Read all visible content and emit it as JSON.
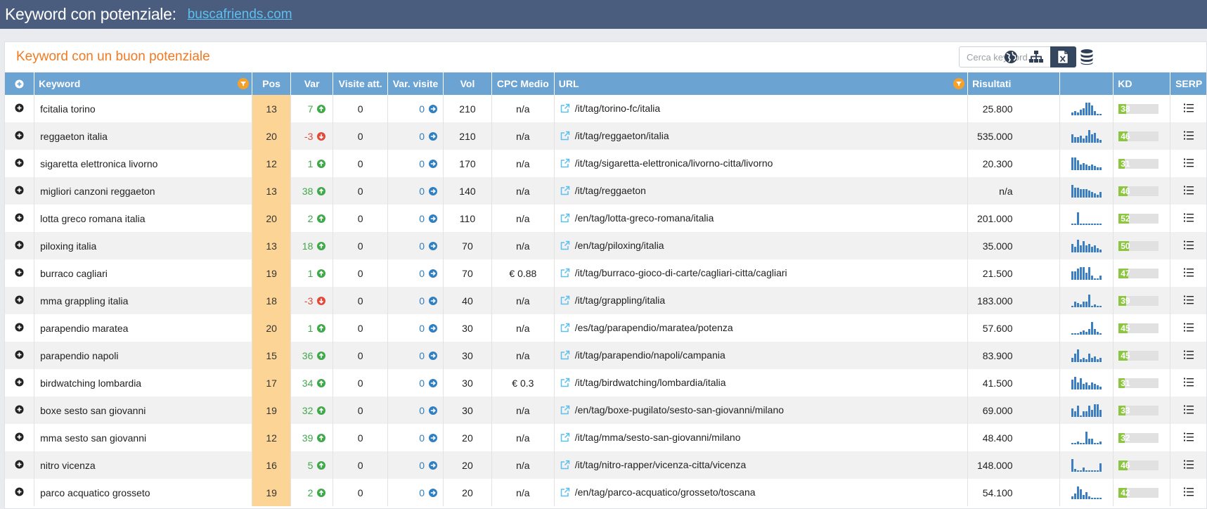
{
  "header": {
    "title": "Keyword con potenziale:",
    "domain": "buscafriends.com"
  },
  "panel": {
    "title": "Keyword con un buon potenziale",
    "search_placeholder": "Cerca keyword..."
  },
  "toolbar_icons": [
    "globe-icon",
    "sitemap-icon",
    "excel-icon",
    "database-icon"
  ],
  "columns": [
    "Keyword",
    "Pos",
    "Var",
    "Visite att.",
    "Var. visite",
    "Vol",
    "CPC Medio",
    "URL",
    "Risultati",
    "",
    "KD",
    "SERP"
  ],
  "colors": {
    "header_bg": "#4b5d7e",
    "table_header": "#6ba3d2",
    "accent": "#f07a23",
    "pos_bg": "#fcd596",
    "up": "#3fa84a",
    "down": "#e14a3a",
    "kd_fill": "#8cc640",
    "trend_bar": "#3b7ec2"
  },
  "rows": [
    {
      "keyword": "fcitalia torino",
      "pos": "13",
      "var": "7",
      "dir": "up",
      "visits": "0",
      "var_visits": "0",
      "vol": "210",
      "cpc": "n/a",
      "url": "/it/tag/torino-fc/italia",
      "results": "25.800",
      "kd": "38",
      "trend": [
        2,
        3,
        2,
        4,
        5,
        9,
        9,
        7,
        3,
        1,
        1
      ]
    },
    {
      "keyword": "reggaeton italia",
      "pos": "20",
      "var": "-3",
      "dir": "down",
      "visits": "0",
      "var_visits": "0",
      "vol": "210",
      "cpc": "n/a",
      "url": "/it/tag/reggaeton/italia",
      "results": "535.000",
      "kd": "46",
      "trend": [
        6,
        4,
        4,
        5,
        3,
        5,
        9,
        6,
        7,
        3,
        2
      ]
    },
    {
      "keyword": "sigaretta elettronica livorno",
      "pos": "12",
      "var": "1",
      "dir": "up",
      "visits": "0",
      "var_visits": "0",
      "vol": "170",
      "cpc": "n/a",
      "url": "/it/tag/sigaretta-elettronica/livorno-citta/livorno",
      "results": "20.300",
      "kd": "31",
      "trend": [
        9,
        9,
        7,
        4,
        5,
        4,
        3,
        4,
        3,
        2,
        2
      ]
    },
    {
      "keyword": "migliori canzoni reggaeton",
      "pos": "13",
      "var": "38",
      "dir": "up",
      "visits": "0",
      "var_visits": "0",
      "vol": "140",
      "cpc": "n/a",
      "url": "/it/tag/reggaeton",
      "results": "n/a",
      "kd": "46",
      "trend": [
        9,
        7,
        7,
        6,
        6,
        6,
        5,
        4,
        3,
        2,
        4
      ]
    },
    {
      "keyword": "lotta greco romana italia",
      "pos": "20",
      "var": "2",
      "dir": "up",
      "visits": "0",
      "var_visits": "0",
      "vol": "110",
      "cpc": "n/a",
      "url": "/en/tag/lotta-greco-romana/italia",
      "results": "201.000",
      "kd": "52",
      "trend": [
        1,
        1,
        9,
        1,
        1,
        1,
        1,
        1,
        1,
        1,
        1
      ]
    },
    {
      "keyword": "piloxing italia",
      "pos": "13",
      "var": "18",
      "dir": "up",
      "visits": "0",
      "var_visits": "0",
      "vol": "70",
      "cpc": "n/a",
      "url": "/en/tag/piloxing/italia",
      "results": "35.000",
      "kd": "50",
      "trend": [
        6,
        4,
        9,
        5,
        8,
        5,
        6,
        4,
        5,
        3,
        2
      ]
    },
    {
      "keyword": "burraco cagliari",
      "pos": "19",
      "var": "1",
      "dir": "up",
      "visits": "0",
      "var_visits": "0",
      "vol": "70",
      "cpc": "€ 0.88",
      "url": "/it/tag/burraco-gioco-di-carte/cagliari-citta/cagliari",
      "results": "21.500",
      "kd": "47",
      "trend": [
        6,
        6,
        8,
        9,
        9,
        5,
        9,
        3,
        1,
        1,
        3
      ]
    },
    {
      "keyword": "mma grappling italia",
      "pos": "18",
      "var": "-3",
      "dir": "down",
      "visits": "0",
      "var_visits": "0",
      "vol": "40",
      "cpc": "n/a",
      "url": "/it/tag/grappling/italia",
      "results": "183.000",
      "kd": "39",
      "trend": [
        1,
        4,
        3,
        2,
        4,
        4,
        9,
        1,
        2,
        1,
        1
      ]
    },
    {
      "keyword": "parapendio maratea",
      "pos": "20",
      "var": "1",
      "dir": "up",
      "visits": "0",
      "var_visits": "0",
      "vol": "30",
      "cpc": "n/a",
      "url": "/es/tag/parapendio/maratea/potenza",
      "results": "57.600",
      "kd": "45",
      "trend": [
        1,
        1,
        1,
        2,
        3,
        2,
        4,
        9,
        4,
        2,
        1
      ]
    },
    {
      "keyword": "parapendio napoli",
      "pos": "15",
      "var": "36",
      "dir": "up",
      "visits": "0",
      "var_visits": "0",
      "vol": "30",
      "cpc": "n/a",
      "url": "/it/tag/parapendio/napoli/campania",
      "results": "83.900",
      "kd": "45",
      "trend": [
        3,
        6,
        9,
        2,
        3,
        2,
        6,
        3,
        4,
        2,
        3
      ]
    },
    {
      "keyword": "birdwatching lombardia",
      "pos": "17",
      "var": "34",
      "dir": "up",
      "visits": "0",
      "var_visits": "0",
      "vol": "30",
      "cpc": "€ 0.3",
      "url": "/it/tag/birdwatching/lombardia/italia",
      "results": "41.500",
      "kd": "31",
      "trend": [
        7,
        9,
        5,
        8,
        4,
        5,
        3,
        5,
        4,
        3,
        2
      ]
    },
    {
      "keyword": "boxe sesto san giovanni",
      "pos": "19",
      "var": "32",
      "dir": "up",
      "visits": "0",
      "var_visits": "0",
      "vol": "30",
      "cpc": "n/a",
      "url": "/en/tag/boxe-pugilato/sesto-san-giovanni/milano",
      "results": "69.000",
      "kd": "33",
      "trend": [
        6,
        4,
        8,
        1,
        4,
        4,
        8,
        5,
        9,
        9,
        5
      ]
    },
    {
      "keyword": "mma sesto san giovanni",
      "pos": "12",
      "var": "39",
      "dir": "up",
      "visits": "0",
      "var_visits": "0",
      "vol": "20",
      "cpc": "n/a",
      "url": "/it/tag/mma/sesto-san-giovanni/milano",
      "results": "48.400",
      "kd": "32",
      "trend": [
        1,
        1,
        2,
        1,
        1,
        9,
        4,
        4,
        1,
        1,
        2
      ]
    },
    {
      "keyword": "nitro vicenza",
      "pos": "16",
      "var": "5",
      "dir": "up",
      "visits": "0",
      "var_visits": "0",
      "vol": "20",
      "cpc": "n/a",
      "url": "/it/tag/nitro-rapper/vicenza-citta/vicenza",
      "results": "148.000",
      "kd": "46",
      "trend": [
        9,
        2,
        1,
        1,
        3,
        1,
        1,
        1,
        1,
        1,
        6
      ]
    },
    {
      "keyword": "parco acquatico grosseto",
      "pos": "19",
      "var": "2",
      "dir": "up",
      "visits": "0",
      "var_visits": "0",
      "vol": "20",
      "cpc": "n/a",
      "url": "/en/tag/parco-acquatico/grosseto/toscana",
      "results": "54.100",
      "kd": "42",
      "trend": [
        2,
        4,
        9,
        7,
        3,
        5,
        2,
        1,
        1,
        1,
        1
      ]
    }
  ]
}
